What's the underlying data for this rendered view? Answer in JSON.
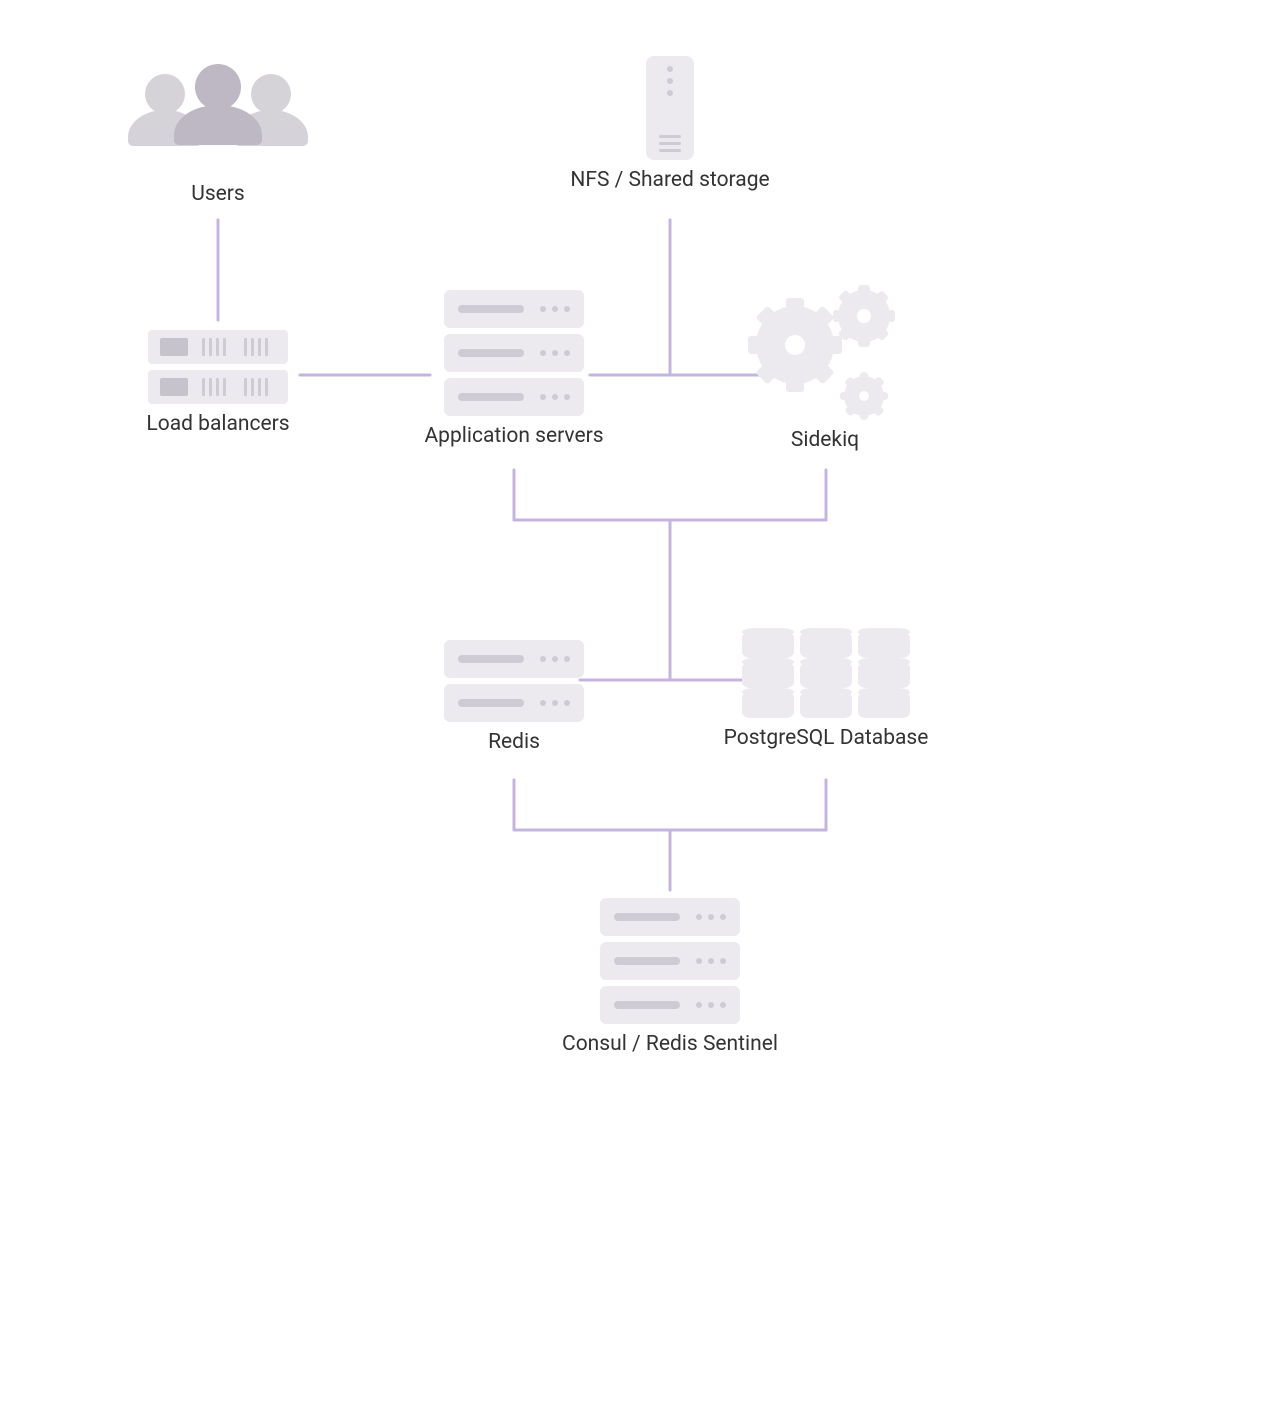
{
  "nodes": {
    "users": {
      "label": "Users"
    },
    "nfs": {
      "label": "NFS / Shared storage"
    },
    "loadBalancers": {
      "label": "Load balancers"
    },
    "appServers": {
      "label": "Application servers"
    },
    "sidekiq": {
      "label": "Sidekiq"
    },
    "redis": {
      "label": "Redis"
    },
    "postgres": {
      "label": "PostgreSQL Database"
    },
    "consul": {
      "label": "Consul  /  Redis Sentinel"
    }
  },
  "colors": {
    "line": "#c4b5e0",
    "iconFill": "#eceaee",
    "iconAccent": "#cfcbd4",
    "iconDark": "#c7c3cc",
    "text": "#333333"
  }
}
